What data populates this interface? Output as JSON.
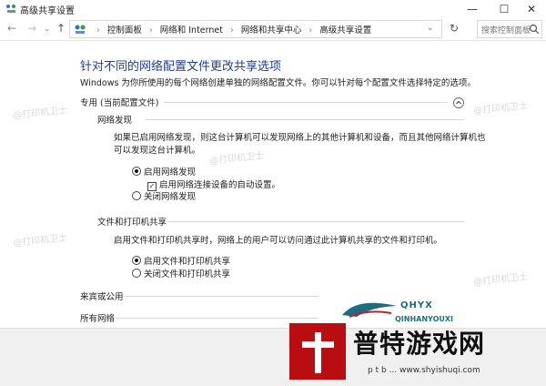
{
  "window": {
    "title": "高级共享设置",
    "controls": {
      "minimize": "—",
      "maximize": "☐",
      "close": "✕"
    }
  },
  "nav": {
    "back": "←",
    "forward": "→",
    "dropdown": "⌄",
    "up": "↑",
    "breadcrumbs": [
      "控制面板",
      "网络和 Internet",
      "网络和共享中心",
      "高级共享设置"
    ],
    "address_dropdown": "⌄",
    "refresh": "↻",
    "search_placeholder": "搜索控制面板"
  },
  "main": {
    "heading": "针对不同的网络配置文件更改共享选项",
    "description": "Windows 为你所使用的每个网络创建单独的网络配置文件。你可以针对每个配置文件选择特定的选项。",
    "private_profile": {
      "title": "专用 (当前配置文件)",
      "network_discovery": {
        "title": "网络发现",
        "paragraph_line1": "如果已启用网络发现，则这台计算机可以发现网络上的其他计算机和设备，而且其他网络计算机也",
        "paragraph_line2": "可以发现这台计算机。",
        "opt_on": "启用网络发现",
        "opt_auto": "启用网络连接设备的自动设置。",
        "opt_off": "关闭网络发现"
      },
      "file_printer_sharing": {
        "title": "文件和打印机共享",
        "paragraph": "启用文件和打印机共享时，网络上的用户可以访问通过此计算机共享的文件和打印机。",
        "opt_on": "启用文件和打印机共享",
        "opt_off": "关闭文件和打印机共享"
      }
    },
    "guest_public": {
      "title": "来宾或公用"
    },
    "all_networks": {
      "title": "所有网络"
    }
  },
  "watermark": {
    "text1": "@打印机卫士",
    "text2": "@打印机卫士",
    "text3": "@打印机卫士",
    "text4": "@打印机卫士",
    "text5": "@打印机卫士"
  },
  "brand": {
    "logo_top": "QHYX",
    "logo_sub": "QINHANYOUXI",
    "main": "普特游戏网",
    "url": "p t b ... www.shyishuqi.com"
  }
}
